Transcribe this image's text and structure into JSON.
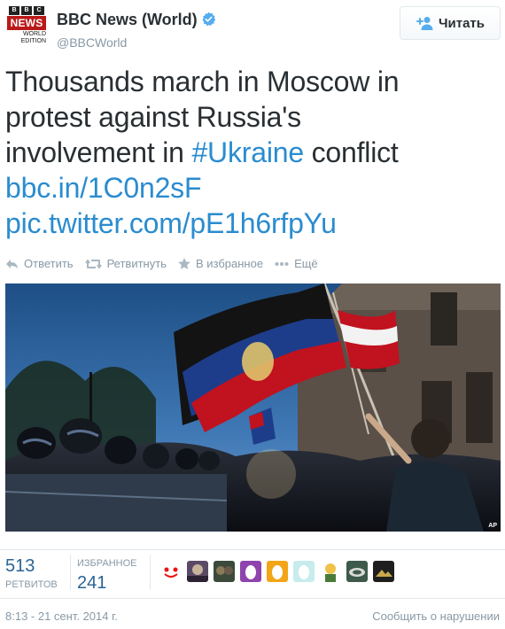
{
  "account": {
    "logo_bbc": [
      "B",
      "B",
      "C"
    ],
    "logo_news": "NEWS",
    "logo_world": "WORLD EDITION",
    "name": "BBC News (World)",
    "handle": "@BBCWorld"
  },
  "follow_button": {
    "label": "Читать"
  },
  "tweet": {
    "line1": "Thousands march in Moscow in",
    "line2": "protest against Russia's",
    "line3_before": "involvement in ",
    "hashtag": "#Ukraine",
    "line3_after": " conflict",
    "link1": "bbc.in/1C0n2sF",
    "link2": "pic.twitter.com/pE1h6rfpYu"
  },
  "actions": {
    "reply": "Ответить",
    "retweet": "Ретвитнуть",
    "favorite": "В избранное",
    "more": "Ещё"
  },
  "photo": {
    "credit": "AP"
  },
  "stats": {
    "retweets_value": "513",
    "retweets_label": "РЕТВИТОВ",
    "favorites_label": "ИЗБРАННОЕ",
    "favorites_value": "241"
  },
  "footer": {
    "timestamp": "8:13 - 21 сент. 2014 г.",
    "report": "Сообщить о нарушении"
  },
  "colors": {
    "link": "#2a8ccf",
    "verified": "#55acee",
    "muted": "#8899a6",
    "bbc_red": "#bb1919"
  }
}
